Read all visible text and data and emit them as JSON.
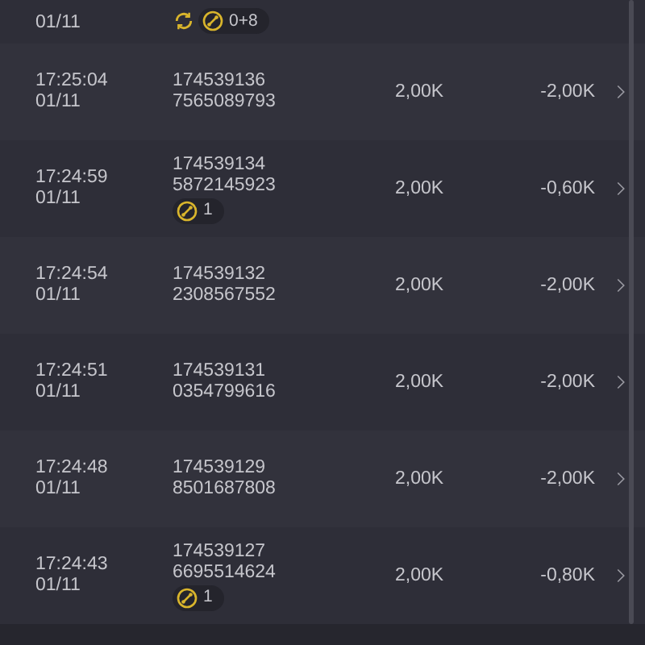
{
  "rows": [
    {
      "date": "01/11",
      "badges": [
        {
          "kind": "cycle"
        },
        {
          "kind": "coin",
          "count": "0+8"
        }
      ]
    },
    {
      "time": "17:25:04",
      "date": "01/11",
      "ids": [
        "174539136",
        "7565089793"
      ],
      "amount": "2,00K",
      "result": "-2,00K"
    },
    {
      "time": "17:24:59",
      "date": "01/11",
      "ids": [
        "174539134",
        "5872145923"
      ],
      "badges": [
        {
          "kind": "coin",
          "count": "1"
        }
      ],
      "amount": "2,00K",
      "result": "-0,60K"
    },
    {
      "time": "17:24:54",
      "date": "01/11",
      "ids": [
        "174539132",
        "2308567552"
      ],
      "amount": "2,00K",
      "result": "-2,00K"
    },
    {
      "time": "17:24:51",
      "date": "01/11",
      "ids": [
        "174539131",
        "0354799616"
      ],
      "amount": "2,00K",
      "result": "-2,00K"
    },
    {
      "time": "17:24:48",
      "date": "01/11",
      "ids": [
        "174539129",
        "8501687808"
      ],
      "amount": "2,00K",
      "result": "-2,00K"
    },
    {
      "time": "17:24:43",
      "date": "01/11",
      "ids": [
        "174539127",
        "6695514624"
      ],
      "badges": [
        {
          "kind": "coin",
          "count": "1"
        }
      ],
      "amount": "2,00K",
      "result": "-0,80K"
    }
  ]
}
